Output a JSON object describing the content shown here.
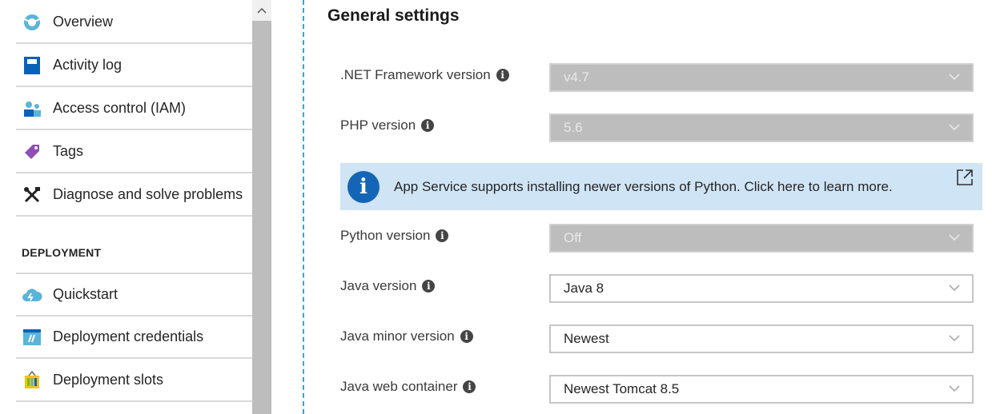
{
  "sidebar": {
    "items": [
      {
        "label": "Overview",
        "icon": "overview-icon"
      },
      {
        "label": "Activity log",
        "icon": "activity-log-icon"
      },
      {
        "label": "Access control (IAM)",
        "icon": "access-control-icon"
      },
      {
        "label": "Tags",
        "icon": "tag-icon"
      },
      {
        "label": "Diagnose and solve problems",
        "icon": "wrench-icon"
      }
    ],
    "section_heading": "DEPLOYMENT",
    "deployment_items": [
      {
        "label": "Quickstart",
        "icon": "quickstart-cloud-icon"
      },
      {
        "label": "Deployment credentials",
        "icon": "credentials-icon"
      },
      {
        "label": "Deployment slots",
        "icon": "slots-icon"
      }
    ]
  },
  "main": {
    "title": "General settings",
    "settings": [
      {
        "label": ".NET Framework version",
        "value": "v4.7",
        "disabled": true
      },
      {
        "label": "PHP version",
        "value": "5.6",
        "disabled": true
      },
      {
        "label": "Python version",
        "value": "Off",
        "disabled": true
      },
      {
        "label": "Java version",
        "value": "Java 8",
        "disabled": false
      },
      {
        "label": "Java minor version",
        "value": "Newest",
        "disabled": false
      },
      {
        "label": "Java web container",
        "value": "Newest Tomcat 8.5",
        "disabled": false
      }
    ],
    "banner": {
      "text": "App Service supports installing newer versions of Python. Click here to learn more.",
      "icon": "info-icon"
    },
    "info_glyph": "i"
  },
  "colors": {
    "accent_blue": "#1565b6",
    "banner_bg": "#cfe4f5",
    "disabled_select": "#bdbdbd",
    "divider": "#39a0d8"
  }
}
